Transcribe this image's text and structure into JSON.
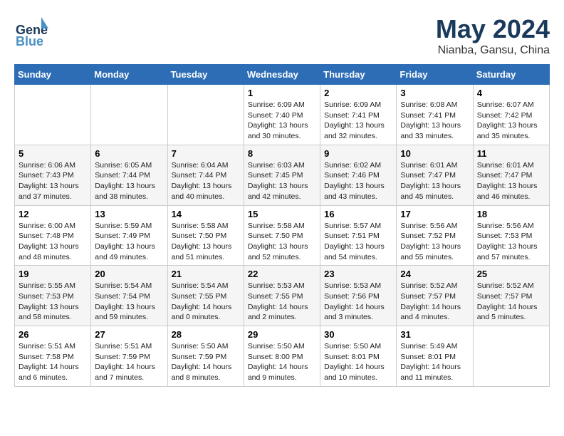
{
  "logo": {
    "part1": "General",
    "part2": "Blue"
  },
  "header": {
    "month": "May 2024",
    "location": "Nianba, Gansu, China"
  },
  "weekdays": [
    "Sunday",
    "Monday",
    "Tuesday",
    "Wednesday",
    "Thursday",
    "Friday",
    "Saturday"
  ],
  "weeks": [
    [
      {
        "day": "",
        "info": ""
      },
      {
        "day": "",
        "info": ""
      },
      {
        "day": "",
        "info": ""
      },
      {
        "day": "1",
        "info": "Sunrise: 6:09 AM\nSunset: 7:40 PM\nDaylight: 13 hours\nand 30 minutes."
      },
      {
        "day": "2",
        "info": "Sunrise: 6:09 AM\nSunset: 7:41 PM\nDaylight: 13 hours\nand 32 minutes."
      },
      {
        "day": "3",
        "info": "Sunrise: 6:08 AM\nSunset: 7:41 PM\nDaylight: 13 hours\nand 33 minutes."
      },
      {
        "day": "4",
        "info": "Sunrise: 6:07 AM\nSunset: 7:42 PM\nDaylight: 13 hours\nand 35 minutes."
      }
    ],
    [
      {
        "day": "5",
        "info": "Sunrise: 6:06 AM\nSunset: 7:43 PM\nDaylight: 13 hours\nand 37 minutes."
      },
      {
        "day": "6",
        "info": "Sunrise: 6:05 AM\nSunset: 7:44 PM\nDaylight: 13 hours\nand 38 minutes."
      },
      {
        "day": "7",
        "info": "Sunrise: 6:04 AM\nSunset: 7:44 PM\nDaylight: 13 hours\nand 40 minutes."
      },
      {
        "day": "8",
        "info": "Sunrise: 6:03 AM\nSunset: 7:45 PM\nDaylight: 13 hours\nand 42 minutes."
      },
      {
        "day": "9",
        "info": "Sunrise: 6:02 AM\nSunset: 7:46 PM\nDaylight: 13 hours\nand 43 minutes."
      },
      {
        "day": "10",
        "info": "Sunrise: 6:01 AM\nSunset: 7:47 PM\nDaylight: 13 hours\nand 45 minutes."
      },
      {
        "day": "11",
        "info": "Sunrise: 6:01 AM\nSunset: 7:47 PM\nDaylight: 13 hours\nand 46 minutes."
      }
    ],
    [
      {
        "day": "12",
        "info": "Sunrise: 6:00 AM\nSunset: 7:48 PM\nDaylight: 13 hours\nand 48 minutes."
      },
      {
        "day": "13",
        "info": "Sunrise: 5:59 AM\nSunset: 7:49 PM\nDaylight: 13 hours\nand 49 minutes."
      },
      {
        "day": "14",
        "info": "Sunrise: 5:58 AM\nSunset: 7:50 PM\nDaylight: 13 hours\nand 51 minutes."
      },
      {
        "day": "15",
        "info": "Sunrise: 5:58 AM\nSunset: 7:50 PM\nDaylight: 13 hours\nand 52 minutes."
      },
      {
        "day": "16",
        "info": "Sunrise: 5:57 AM\nSunset: 7:51 PM\nDaylight: 13 hours\nand 54 minutes."
      },
      {
        "day": "17",
        "info": "Sunrise: 5:56 AM\nSunset: 7:52 PM\nDaylight: 13 hours\nand 55 minutes."
      },
      {
        "day": "18",
        "info": "Sunrise: 5:56 AM\nSunset: 7:53 PM\nDaylight: 13 hours\nand 57 minutes."
      }
    ],
    [
      {
        "day": "19",
        "info": "Sunrise: 5:55 AM\nSunset: 7:53 PM\nDaylight: 13 hours\nand 58 minutes."
      },
      {
        "day": "20",
        "info": "Sunrise: 5:54 AM\nSunset: 7:54 PM\nDaylight: 13 hours\nand 59 minutes."
      },
      {
        "day": "21",
        "info": "Sunrise: 5:54 AM\nSunset: 7:55 PM\nDaylight: 14 hours\nand 0 minutes."
      },
      {
        "day": "22",
        "info": "Sunrise: 5:53 AM\nSunset: 7:55 PM\nDaylight: 14 hours\nand 2 minutes."
      },
      {
        "day": "23",
        "info": "Sunrise: 5:53 AM\nSunset: 7:56 PM\nDaylight: 14 hours\nand 3 minutes."
      },
      {
        "day": "24",
        "info": "Sunrise: 5:52 AM\nSunset: 7:57 PM\nDaylight: 14 hours\nand 4 minutes."
      },
      {
        "day": "25",
        "info": "Sunrise: 5:52 AM\nSunset: 7:57 PM\nDaylight: 14 hours\nand 5 minutes."
      }
    ],
    [
      {
        "day": "26",
        "info": "Sunrise: 5:51 AM\nSunset: 7:58 PM\nDaylight: 14 hours\nand 6 minutes."
      },
      {
        "day": "27",
        "info": "Sunrise: 5:51 AM\nSunset: 7:59 PM\nDaylight: 14 hours\nand 7 minutes."
      },
      {
        "day": "28",
        "info": "Sunrise: 5:50 AM\nSunset: 7:59 PM\nDaylight: 14 hours\nand 8 minutes."
      },
      {
        "day": "29",
        "info": "Sunrise: 5:50 AM\nSunset: 8:00 PM\nDaylight: 14 hours\nand 9 minutes."
      },
      {
        "day": "30",
        "info": "Sunrise: 5:50 AM\nSunset: 8:01 PM\nDaylight: 14 hours\nand 10 minutes."
      },
      {
        "day": "31",
        "info": "Sunrise: 5:49 AM\nSunset: 8:01 PM\nDaylight: 14 hours\nand 11 minutes."
      },
      {
        "day": "",
        "info": ""
      }
    ]
  ]
}
